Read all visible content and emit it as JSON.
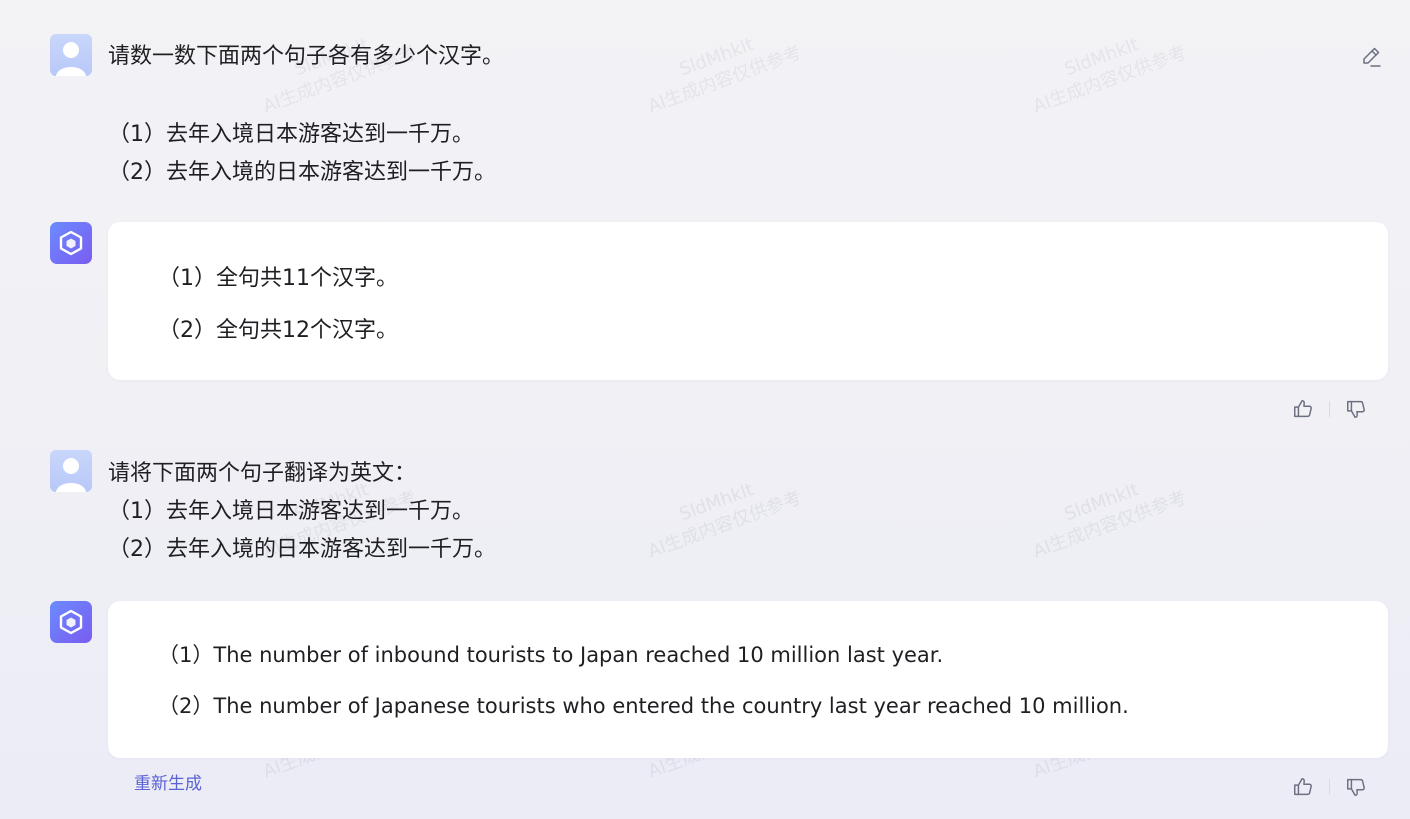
{
  "conversation": {
    "q1": {
      "prompt": "请数一数下面两个句子各有多少个汉字。",
      "line1": "（1）去年入境日本游客达到一千万。",
      "line2": "（2）去年入境的日本游客达到一千万。"
    },
    "a1": {
      "line1": "（1）全句共11个汉字。",
      "line2": "（2）全句共12个汉字。"
    },
    "q2": {
      "prompt": "请将下面两个句子翻译为英文：",
      "line1": "（1）去年入境日本游客达到一千万。",
      "line2": "（2）去年入境的日本游客达到一千万。"
    },
    "a2": {
      "line1": "（1）The number of inbound tourists to Japan reached 10 million last year.",
      "line2": "（2）The number of Japanese tourists who entered the country last year reached 10 million."
    },
    "regenerate_label": "重新生成"
  },
  "watermark": {
    "line1": "SldMhklt",
    "line2": "AI生成内容仅供参考"
  },
  "icons": {
    "edit": "edit-icon",
    "like": "thumbs-up-icon",
    "dislike": "thumbs-down-icon",
    "bot": "bot-logo-icon",
    "user": "user-avatar-icon"
  },
  "colors": {
    "accent": "#5b63d3",
    "bot_gradient_start": "#6b8bff",
    "bot_gradient_end": "#7a5cf0"
  }
}
